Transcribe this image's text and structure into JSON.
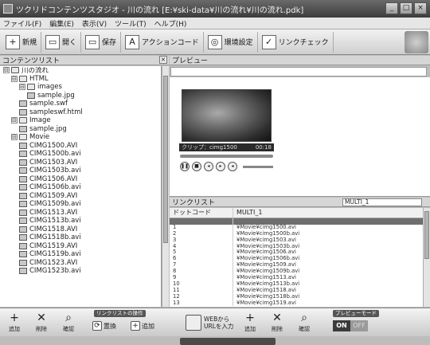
{
  "window": {
    "title": "ツクリドコンテンツスタジオ - 川の流れ [E:¥ski-data¥川の流れ¥川の流れ.pdk]",
    "buttons": [
      "_",
      "□",
      "×"
    ]
  },
  "menu": [
    "ファイル(F)",
    "編集(E)",
    "表示(V)",
    "ツール(T)",
    "ヘルプ(H)"
  ],
  "toolbar": [
    {
      "icon": "new-icon",
      "glyph": "+",
      "label": "新規"
    },
    {
      "icon": "open-icon",
      "glyph": "▭",
      "label": "開く"
    },
    {
      "icon": "save-icon",
      "glyph": "▭",
      "label": "保存"
    },
    {
      "icon": "action-code-icon",
      "glyph": "A",
      "label": "アクションコード"
    },
    {
      "icon": "settings-icon",
      "glyph": "◎",
      "label": "環境設定"
    },
    {
      "icon": "link-check-icon",
      "glyph": "✓",
      "label": "リンクチェック"
    }
  ],
  "content_list": {
    "title": "コンテンツリスト",
    "items": [
      {
        "indent": 0,
        "expander": "⊟",
        "type": "folder",
        "label": "川の流れ"
      },
      {
        "indent": 1,
        "expander": "⊟",
        "type": "folder",
        "label": "HTML"
      },
      {
        "indent": 2,
        "expander": "⊟",
        "type": "folder",
        "label": "images"
      },
      {
        "indent": 3,
        "expander": "",
        "type": "file",
        "label": "sample.jpg"
      },
      {
        "indent": 2,
        "expander": "",
        "type": "file",
        "label": "sample.swf"
      },
      {
        "indent": 2,
        "expander": "",
        "type": "file",
        "label": "sampleswf.html"
      },
      {
        "indent": 1,
        "expander": "⊟",
        "type": "folder",
        "label": "Image"
      },
      {
        "indent": 2,
        "expander": "",
        "type": "file",
        "label": "sample.jpg"
      },
      {
        "indent": 1,
        "expander": "⊟",
        "type": "folder",
        "label": "Movie"
      },
      {
        "indent": 2,
        "expander": "",
        "type": "file",
        "label": "CIMG1500.AVI"
      },
      {
        "indent": 2,
        "expander": "",
        "type": "file",
        "label": "CIMG1500b.avi"
      },
      {
        "indent": 2,
        "expander": "",
        "type": "file",
        "label": "CIMG1503.AVI"
      },
      {
        "indent": 2,
        "expander": "",
        "type": "file",
        "label": "CIMG1503b.avi"
      },
      {
        "indent": 2,
        "expander": "",
        "type": "file",
        "label": "CIMG1506.AVI"
      },
      {
        "indent": 2,
        "expander": "",
        "type": "file",
        "label": "CIMG1506b.avi"
      },
      {
        "indent": 2,
        "expander": "",
        "type": "file",
        "label": "CIMG1509.AVI"
      },
      {
        "indent": 2,
        "expander": "",
        "type": "file",
        "label": "CIMG1509b.avi"
      },
      {
        "indent": 2,
        "expander": "",
        "type": "file",
        "label": "CIMG1513.AVI"
      },
      {
        "indent": 2,
        "expander": "",
        "type": "file",
        "label": "CIMG1513b.avi"
      },
      {
        "indent": 2,
        "expander": "",
        "type": "file",
        "label": "CIMG1518.AVI"
      },
      {
        "indent": 2,
        "expander": "",
        "type": "file",
        "label": "CIMG1518b.avi"
      },
      {
        "indent": 2,
        "expander": "",
        "type": "file",
        "label": "CIMG1519.AVI"
      },
      {
        "indent": 2,
        "expander": "",
        "type": "file",
        "label": "CIMG1519b.avi"
      },
      {
        "indent": 2,
        "expander": "",
        "type": "file",
        "label": "CIMG1523.AVI"
      },
      {
        "indent": 2,
        "expander": "",
        "type": "file",
        "label": "CIMG1523b.avi"
      }
    ]
  },
  "preview": {
    "title": "プレビュー",
    "clip_label": "クリップ：cimg1500",
    "clip_time": "00:18"
  },
  "link_list": {
    "title": "リンクリスト",
    "selector_value": "MULTI_1",
    "columns": [
      "ドットコード",
      "MULTI_1"
    ],
    "rows": [
      [
        "1",
        "¥Movie¥cimg1500.avi"
      ],
      [
        "2",
        "¥Movie¥cimg1500b.avi"
      ],
      [
        "3",
        "¥Movie¥cimg1503.avi"
      ],
      [
        "4",
        "¥Movie¥cimg1503b.avi"
      ],
      [
        "5",
        "¥Movie¥cimg1506.avi"
      ],
      [
        "6",
        "¥Movie¥cimg1506b.avi"
      ],
      [
        "7",
        "¥Movie¥cimg1509.avi"
      ],
      [
        "8",
        "¥Movie¥cimg1509b.avi"
      ],
      [
        "9",
        "¥Movie¥cimg1513.avi"
      ],
      [
        "10",
        "¥Movie¥cimg1513b.avi"
      ],
      [
        "11",
        "¥Movie¥cimg1518.avi"
      ],
      [
        "12",
        "¥Movie¥cimg1518b.avi"
      ],
      [
        "13",
        "¥Movie¥cimg1519.avi"
      ]
    ]
  },
  "bottom": {
    "add": "追加",
    "delete": "削除",
    "confirm": "確認",
    "link_ops_label": "リンクリストの操作",
    "replace": "置換",
    "link_add": "追加",
    "web_line1": "WEBから",
    "web_line2": "URLを入力",
    "add2": "追加",
    "delete2": "削除",
    "confirm2": "確認",
    "preview_mode_label": "プレビューモード",
    "on": "ON",
    "off": "OFF"
  }
}
